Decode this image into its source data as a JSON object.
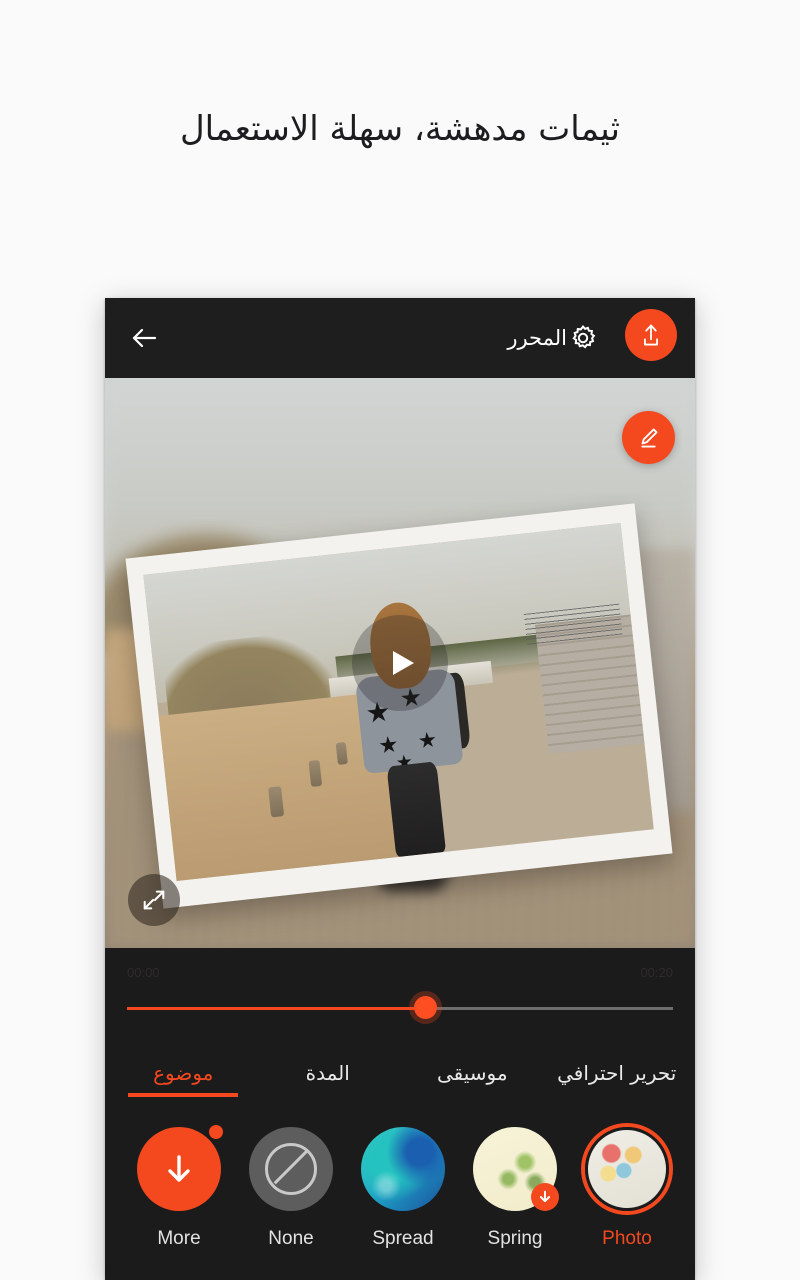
{
  "promo": {
    "headline": "ثيمات مدهشة، سهلة الاستعمال"
  },
  "colors": {
    "accent": "#f4491f",
    "panel_bg": "#1b1b1b",
    "appbar_bg": "#1e1e1e",
    "page_bg": "#fafafa"
  },
  "app_bar": {
    "back_icon": "back-arrow-icon",
    "title": "المحرر",
    "settings_icon": "gear-icon",
    "share_icon": "share-icon"
  },
  "preview": {
    "play_icon": "play-icon",
    "fullscreen_icon": "fullscreen-expand-icon",
    "edit_icon": "pencil-edit-icon"
  },
  "timeline": {
    "start_time": "00:00",
    "end_time": "00:20",
    "progress_percent": 54.5
  },
  "tabs": [
    {
      "label": "موضوع",
      "active": true
    },
    {
      "label": "المدة",
      "active": false
    },
    {
      "label": "موسيقى",
      "active": false
    },
    {
      "label": "تحرير احترافي",
      "active": false
    }
  ],
  "themes": [
    {
      "label": "More",
      "selected": false,
      "badge": "dot",
      "icon": "download-arrow-icon"
    },
    {
      "label": "None",
      "selected": false,
      "badge": "none",
      "icon": "no-theme-icon"
    },
    {
      "label": "Spread",
      "selected": false,
      "badge": "none",
      "icon": ""
    },
    {
      "label": "Spring",
      "selected": false,
      "badge": "download",
      "icon": "download-arrow-icon"
    },
    {
      "label": "Photo",
      "selected": true,
      "badge": "none",
      "icon": ""
    },
    {
      "label": "",
      "selected": false,
      "badge": "none",
      "icon": ""
    }
  ]
}
